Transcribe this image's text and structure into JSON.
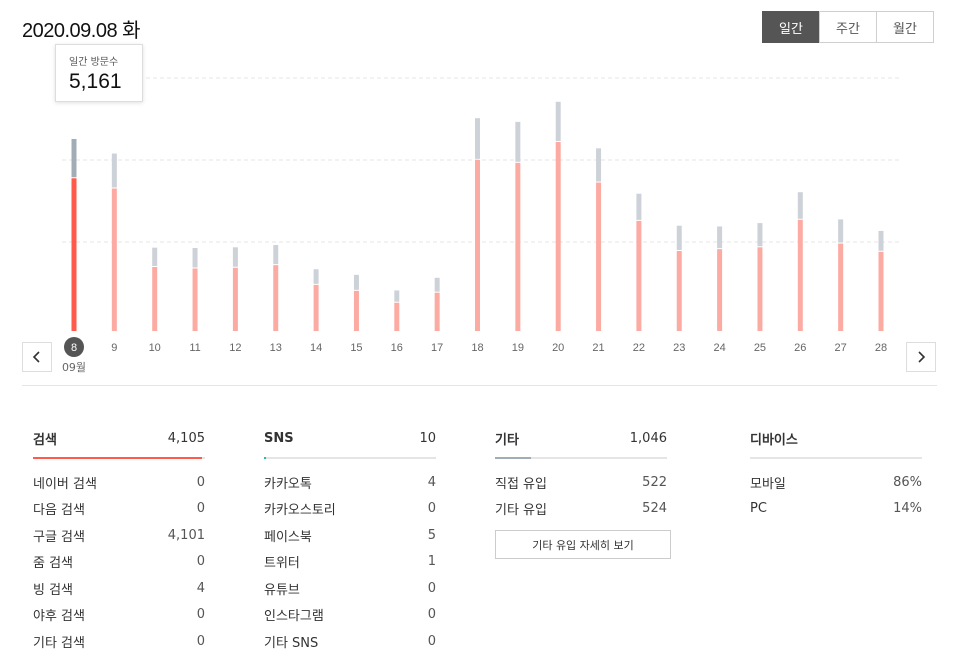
{
  "header": {
    "date": "2020.09.08",
    "weekday": "화"
  },
  "period_tabs": [
    {
      "label": "일간",
      "active": true
    },
    {
      "label": "주간",
      "active": false
    },
    {
      "label": "월간",
      "active": false
    }
  ],
  "tooltip": {
    "label": "일간 방문수",
    "value": "5,161"
  },
  "chart_data": {
    "type": "bar",
    "stacked": true,
    "categories": [
      "8",
      "9",
      "10",
      "11",
      "12",
      "13",
      "14",
      "15",
      "16",
      "17",
      "18",
      "19",
      "20",
      "21",
      "22",
      "23",
      "24",
      "25",
      "26",
      "27",
      "28"
    ],
    "month_label": "09월",
    "selected_index": 0,
    "series": [
      {
        "values": [
          4105,
          3830,
          1720,
          1680,
          1700,
          1770,
          1240,
          1080,
          760,
          1030,
          4600,
          4520,
          5080,
          3990,
          2960,
          2150,
          2200,
          2250,
          2990,
          2350,
          2130
        ]
      },
      {
        "values": [
          1056,
          940,
          520,
          550,
          550,
          540,
          420,
          430,
          330,
          400,
          1120,
          1100,
          1080,
          920,
          730,
          680,
          610,
          650,
          740,
          650,
          560
        ]
      }
    ],
    "ylim": [
      0,
      6800
    ],
    "grid": true,
    "colors": {
      "selected_primary": "#ff5a4a",
      "selected_secondary": "#a2acb6",
      "primary": "#fcaba3",
      "secondary": "#cdd2d8"
    }
  },
  "navigation": {
    "prev_icon": "chevron-left-icon",
    "next_icon": "chevron-right-icon"
  },
  "panels": {
    "search": {
      "title": "검색",
      "total": "4,105",
      "accent": "#ff5a4a",
      "fill_fraction": 0.98,
      "rows": [
        {
          "label": "네이버 검색",
          "value": "0"
        },
        {
          "label": "다음 검색",
          "value": "0"
        },
        {
          "label": "구글 검색",
          "value": "4,101"
        },
        {
          "label": "줌 검색",
          "value": "0"
        },
        {
          "label": "빙 검색",
          "value": "4"
        },
        {
          "label": "야후 검색",
          "value": "0"
        },
        {
          "label": "기타 검색",
          "value": "0"
        }
      ]
    },
    "sns": {
      "title": "SNS",
      "total": "10",
      "accent": "#1fc1a6",
      "fill_fraction": 0.01,
      "rows": [
        {
          "label": "카카오톡",
          "value": "4"
        },
        {
          "label": "카카오스토리",
          "value": "0"
        },
        {
          "label": "페이스북",
          "value": "5"
        },
        {
          "label": "트위터",
          "value": "1"
        },
        {
          "label": "유튜브",
          "value": "0"
        },
        {
          "label": "인스타그램",
          "value": "0"
        },
        {
          "label": "기타 SNS",
          "value": "0"
        }
      ]
    },
    "etc": {
      "title": "기타",
      "total": "1,046",
      "accent": "#a2acb6",
      "fill_fraction": 0.21,
      "rows": [
        {
          "label": "직접 유입",
          "value": "522"
        },
        {
          "label": "기타 유입",
          "value": "524"
        }
      ],
      "detail_button": "기타 유입 자세히 보기"
    },
    "device": {
      "title": "디바이스",
      "rows": [
        {
          "label": "모바일",
          "value": "86%"
        },
        {
          "label": "PC",
          "value": "14%"
        }
      ]
    }
  }
}
